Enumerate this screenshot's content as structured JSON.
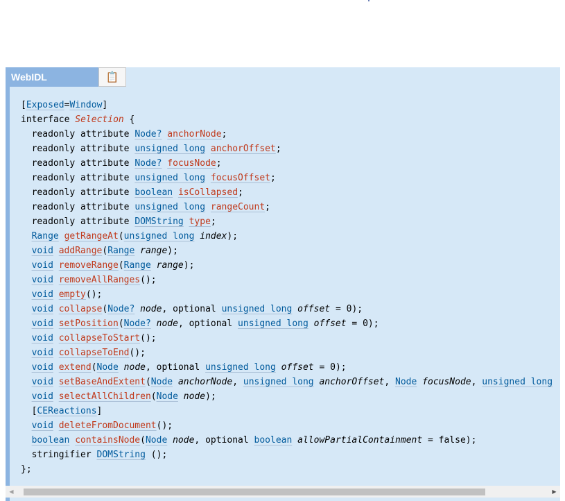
{
  "tab": {
    "label": "WebIDL",
    "copy_icon": "clipboard-icon"
  },
  "code": {
    "ext_open": "[",
    "ext_name": "Exposed",
    "ext_eq": "=",
    "ext_value": "Window",
    "ext_close": "]",
    "iface_keyword": "interface ",
    "iface_name": "Selection",
    "iface_open": " {",
    "ro": "readonly attribute ",
    "attrs": [
      {
        "type": "Node?",
        "name": "anchorNode"
      },
      {
        "type": "unsigned long",
        "name": "anchorOffset"
      },
      {
        "type": "Node?",
        "name": "focusNode"
      },
      {
        "type": "unsigned long",
        "name": "focusOffset"
      },
      {
        "type": "boolean",
        "name": "isCollapsed"
      },
      {
        "type": "unsigned long",
        "name": "rangeCount"
      },
      {
        "type": "DOMString",
        "name": "type"
      }
    ],
    "void": "void",
    "range_type": "Range",
    "get_range_at": "getRangeAt",
    "unsigned_long": "unsigned long",
    "index_arg": "index",
    "add_range": "addRange",
    "range_arg": "range",
    "remove_range": "removeRange",
    "remove_all_ranges": "removeAllRanges",
    "empty": "empty",
    "collapse": "collapse",
    "node_opt": "Node?",
    "node_type": "Node",
    "node_arg": "node",
    "optional": "optional ",
    "offset_arg": "offset",
    "default_zero": " = 0",
    "set_position": "setPosition",
    "collapse_to_start": "collapseToStart",
    "collapse_to_end": "collapseToEnd",
    "extend": "extend",
    "set_base_and_extent": "setBaseAndExtent",
    "anchor_node_arg": "anchorNode",
    "anchor_offset_arg": "anchorOffset",
    "focus_node_arg": "focusNode",
    "select_all_children": "selectAllChildren",
    "ce_open": "[",
    "ce_reactions": "CEReactions",
    "ce_close": "]",
    "delete_from_document": "deleteFromDocument",
    "boolean_type": "boolean",
    "contains_node": "containsNode",
    "allow_partial_arg": "allowPartialContainment",
    "default_false": " = false",
    "stringifier": "stringifier ",
    "domstring": "DOMString",
    "end": "};"
  },
  "scrollbar": {
    "left_arrow": "◀",
    "right_arrow": "▶"
  }
}
